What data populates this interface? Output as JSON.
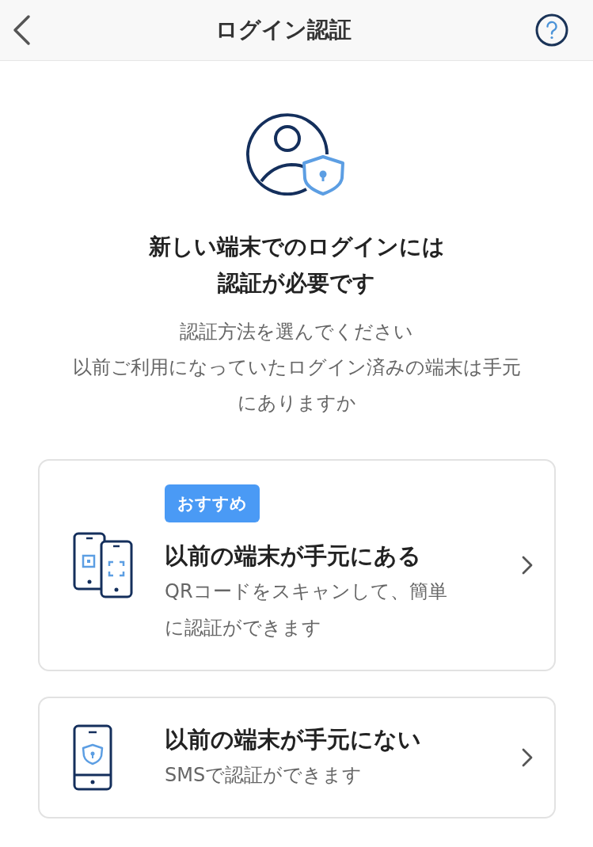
{
  "header": {
    "title": "ログイン認証"
  },
  "heading_lines": [
    "新しい端末でのログインには",
    "認証が必要です"
  ],
  "description_lines": [
    "認証方法を選んでください",
    "以前ご利用になっていたログイン済みの端末は手元",
    "にありますか"
  ],
  "options": [
    {
      "kind": "two-phones",
      "badge": "おすすめ",
      "title": "以前の端末が手元にある",
      "description_lines": [
        "QRコードをスキャンして、簡単",
        "に認証ができます"
      ]
    },
    {
      "kind": "phone-shield",
      "title": "以前の端末が手元にない",
      "description_lines": [
        "SMSで認証ができます"
      ]
    }
  ]
}
